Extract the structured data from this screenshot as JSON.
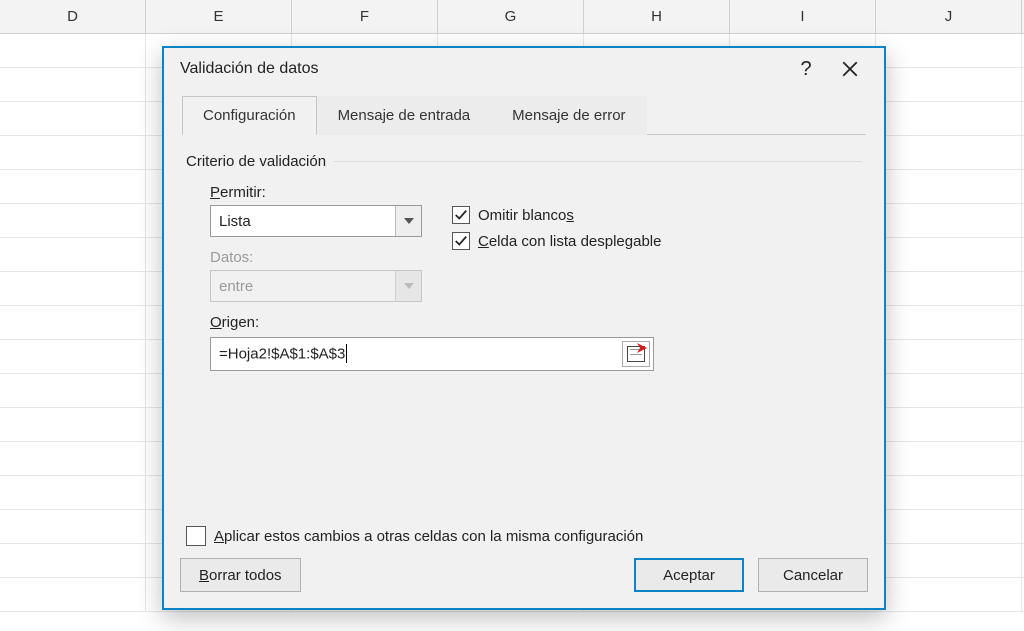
{
  "column_headers": [
    "D",
    "E",
    "F",
    "G",
    "H",
    "I",
    "J"
  ],
  "dialog": {
    "title": "Validación de datos",
    "help": "?",
    "tabs": {
      "config": "Configuración",
      "input_msg": "Mensaje de entrada",
      "error_msg": "Mensaje de error"
    },
    "group_title": "Criterio de validación",
    "permitir_label": "Permitir:",
    "permitir_value": "Lista",
    "datos_label": "Datos:",
    "datos_value": "entre",
    "omitir_label": "Omitir blancos",
    "celda_label": "Celda con lista desplegable",
    "origen_label": "Origen:",
    "origen_value": "=Hoja2!$A$1:$A$3",
    "apply_label": "Aplicar estos cambios a otras celdas con la misma configuración",
    "borrar": "Borrar todos",
    "aceptar": "Aceptar",
    "cancelar": "Cancelar",
    "omitir_checked": true,
    "celda_checked": true,
    "apply_checked": false
  }
}
